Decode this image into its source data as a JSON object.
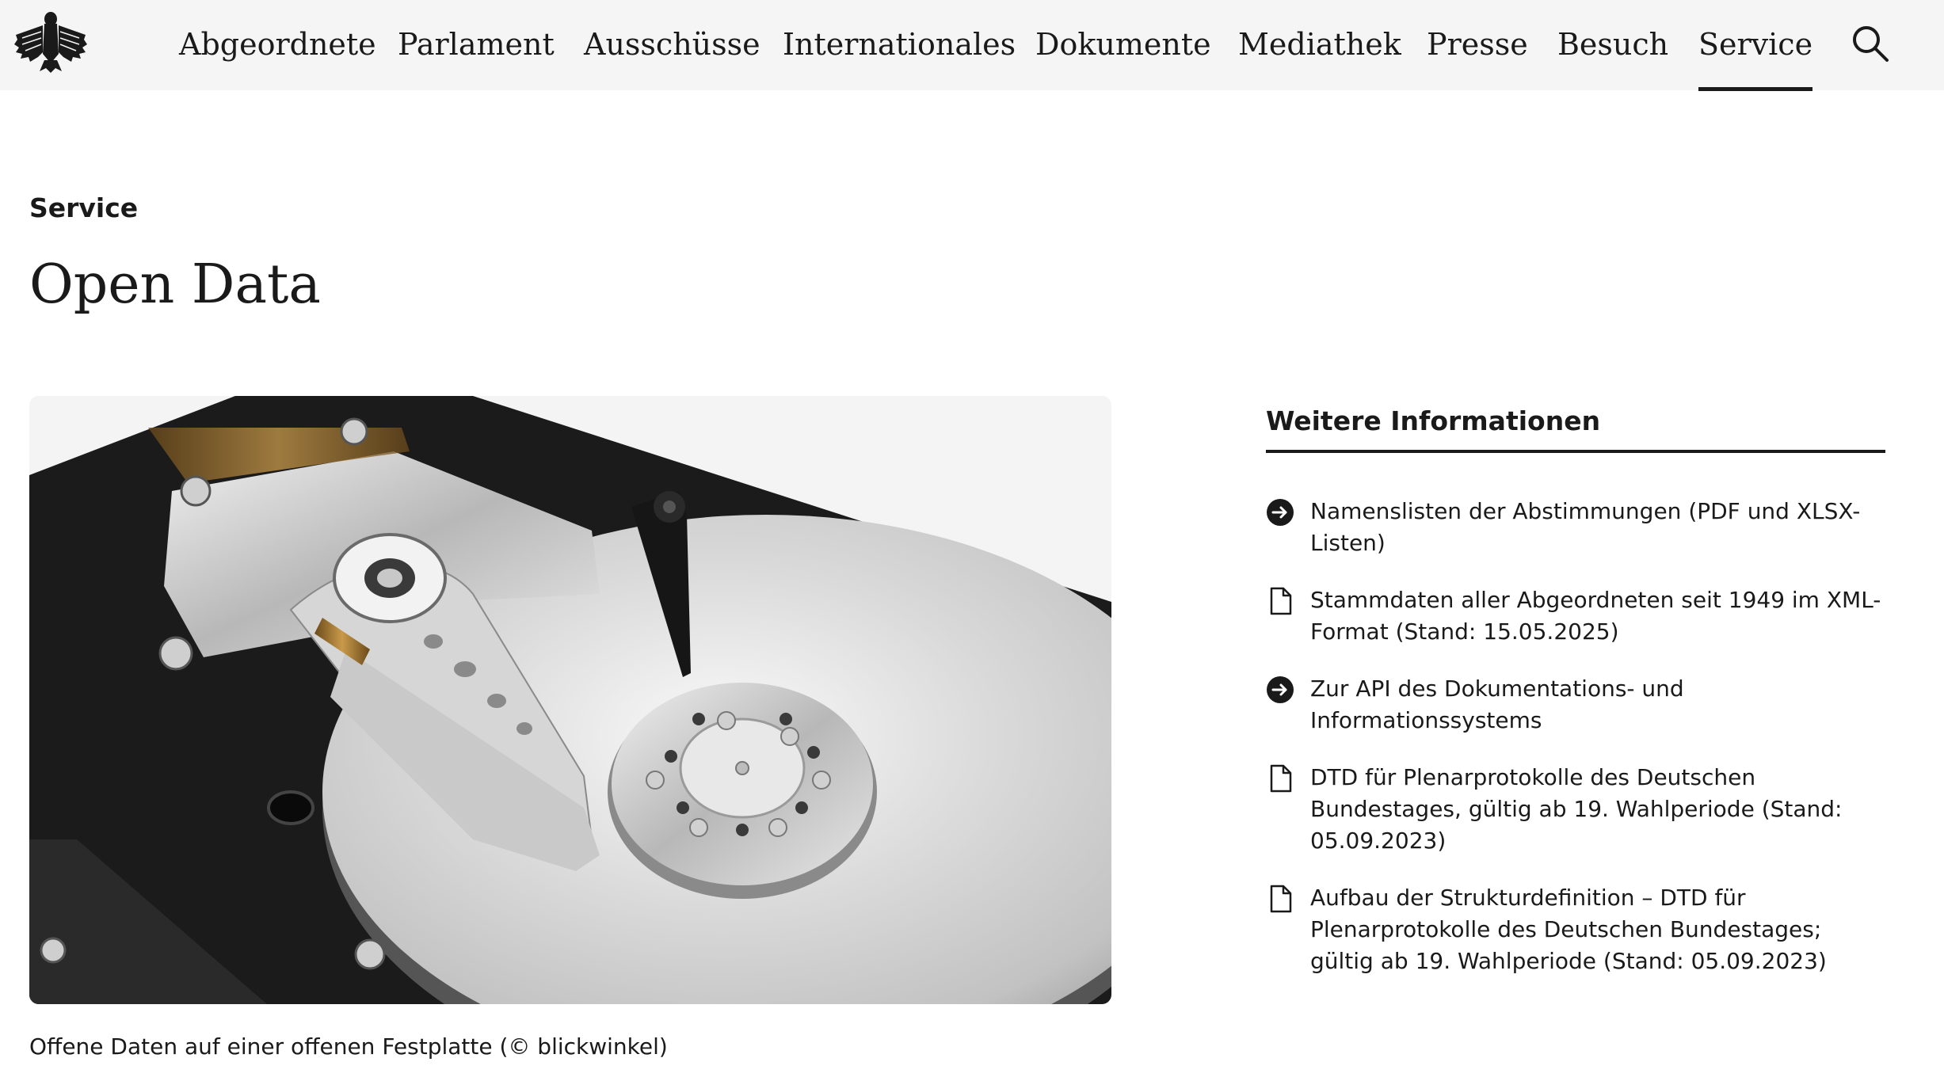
{
  "header": {
    "nav": [
      {
        "label": "Abgeordnete"
      },
      {
        "label": "Parlament"
      },
      {
        "label": "Ausschüsse"
      },
      {
        "label": "Internationales"
      },
      {
        "label": "Dokumente"
      },
      {
        "label": "Mediathek"
      },
      {
        "label": "Presse"
      },
      {
        "label": "Besuch"
      },
      {
        "label": "Service",
        "active": true
      }
    ],
    "logo_icon": "federal-eagle-icon",
    "search_icon": "search-icon"
  },
  "page": {
    "section": "Service",
    "title": "Open Data"
  },
  "hero": {
    "image_subject": "open-hard-disk-drive",
    "caption": "Offene Daten auf einer offenen Festplatte (© blickwinkel)"
  },
  "sidebar": {
    "title": "Weitere Informationen",
    "links": [
      {
        "icon": "arrow-circle-icon",
        "label": "Namenslisten der Abstimmungen (PDF und XLSX-Listen)"
      },
      {
        "icon": "document-icon",
        "label": "Stammdaten aller Abgeordneten seit 1949 im XML-Format (Stand: 15.05.2025)"
      },
      {
        "icon": "arrow-circle-icon",
        "label": "Zur API des Dokumentations- und Informationssystems"
      },
      {
        "icon": "document-icon",
        "label": "DTD für Plenarprotokolle des Deutschen Bundestages, gültig ab 19. Wahlperiode (Stand: 05.09.2023)"
      },
      {
        "icon": "document-icon",
        "label": "Aufbau der Strukturdefinition – DTD für Plenarprotokolle des Deutschen Bundestages; gültig ab 19. Wahlperiode (Stand: 05.09.2023)"
      }
    ]
  }
}
